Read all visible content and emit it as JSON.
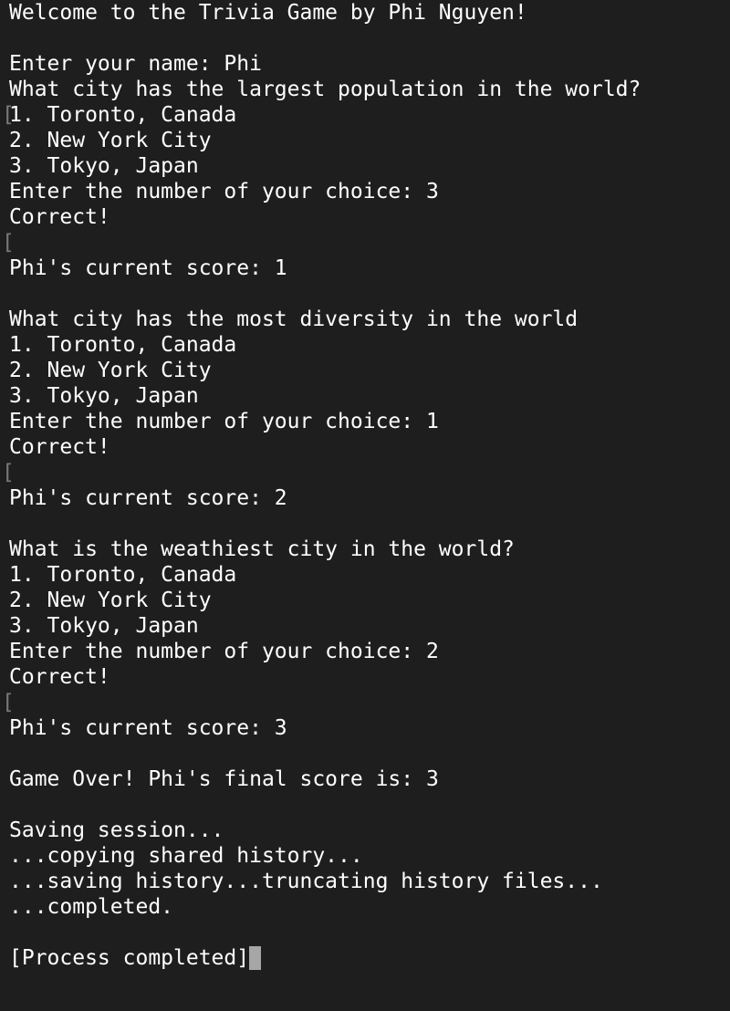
{
  "terminal": {
    "lines": [
      "Welcome to the Trivia Game by Phi Nguyen!",
      "",
      "Enter your name: Phi",
      "What city has the largest population in the world?",
      "1. Toronto, Canada",
      "2. New York City",
      "3. Tokyo, Japan",
      "Enter the number of your choice: 3",
      "Correct!",
      "",
      "Phi's current score: 1",
      "",
      "What city has the most diversity in the world",
      "1. Toronto, Canada",
      "2. New York City",
      "3. Tokyo, Japan",
      "Enter the number of your choice: 1",
      "Correct!",
      "",
      "Phi's current score: 2",
      "",
      "What is the weathiest city in the world?",
      "1. Toronto, Canada",
      "2. New York City",
      "3. Tokyo, Japan",
      "Enter the number of your choice: 2",
      "Correct!",
      "",
      "Phi's current score: 3",
      "",
      "Game Over! Phi's final score is: 3",
      "",
      "Saving session...",
      "...copying shared history...",
      "...saving history...truncating history files...",
      "...completed.",
      "",
      "[Process completed]"
    ],
    "mark_glyph": "["
  },
  "colors": {
    "background": "#1e1e1e",
    "text": "#ffffff",
    "cursor": "#a6a6a6",
    "mark": "#7a7a7a"
  }
}
